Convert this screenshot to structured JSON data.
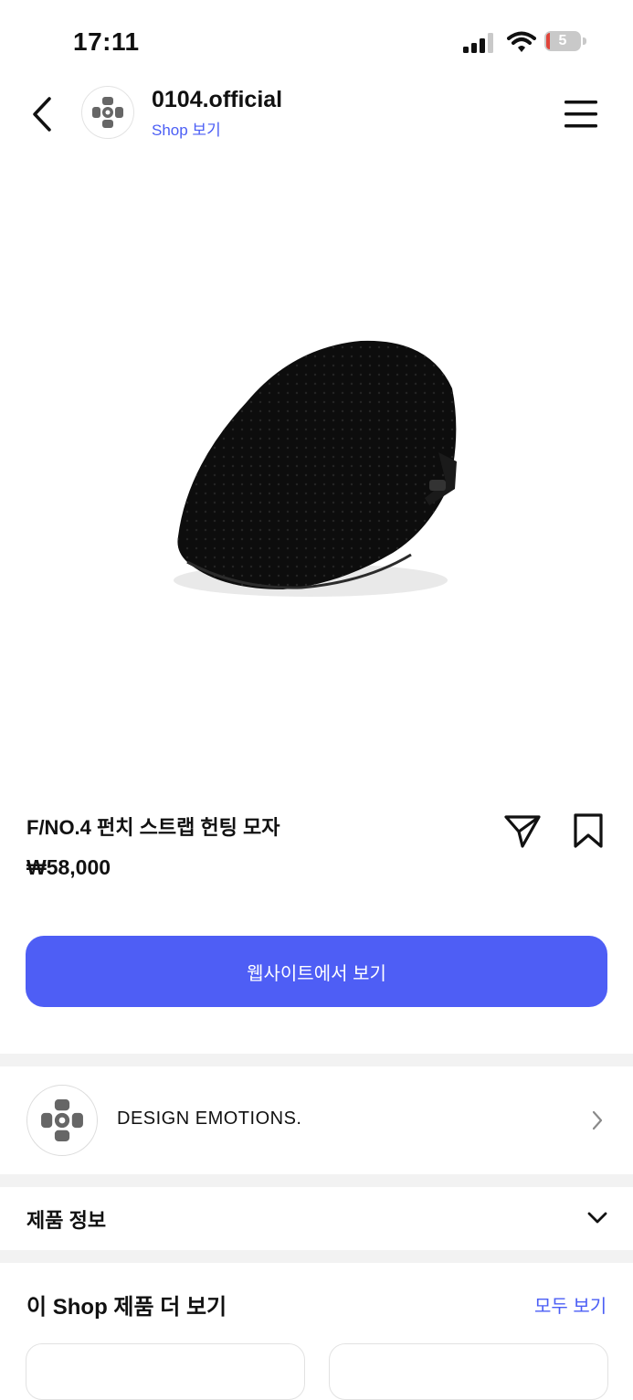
{
  "status_bar": {
    "time": "17:11",
    "battery_level": "5",
    "battery_color": "#e0443a"
  },
  "header": {
    "shop_name": "0104.official",
    "shop_link": "Shop 보기",
    "back_icon": "chevron-left-icon",
    "menu_icon": "hamburger-menu-icon"
  },
  "product": {
    "image": "black-hunting-cap",
    "title": "F/NO.4 펀치 스트랩 헌팅 모자",
    "price": "₩58,000",
    "share_icon": "paper-plane-icon",
    "save_icon": "bookmark-icon"
  },
  "cta": {
    "label": "웹사이트에서 보기",
    "color": "#4e5ef5"
  },
  "brand": {
    "name": "DESIGN EMOTIONS.",
    "logo_icon": "brand-logo-icon"
  },
  "product_info": {
    "label": "제품 정보"
  },
  "more_from_shop": {
    "title": "이 Shop 제품 더 보기",
    "see_all": "모두 보기"
  },
  "accent_color": "#4b5ef5"
}
